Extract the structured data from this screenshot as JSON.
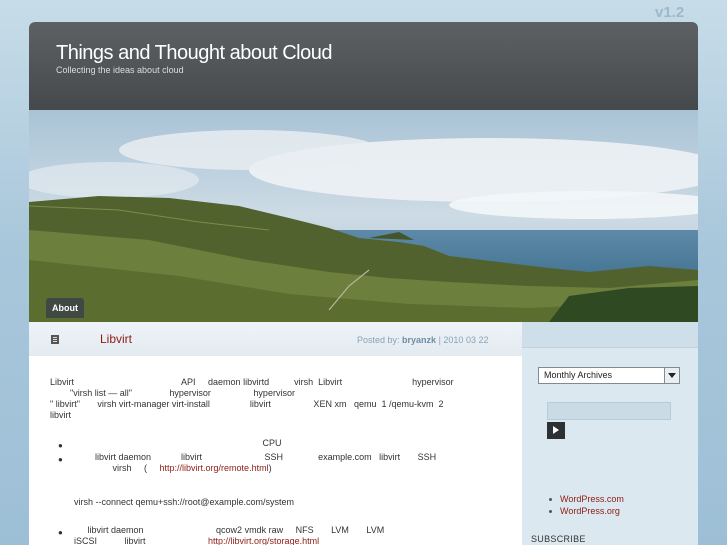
{
  "version": "v1.2",
  "site": {
    "title": "Things and Thought about Cloud",
    "tagline": "Collecting the ideas about cloud"
  },
  "nav": {
    "about": "About"
  },
  "post": {
    "title": "Libvirt",
    "posted_by_label": "Posted by:",
    "author": "bryanzk",
    "date": "| 2010 03 22",
    "lines": [
      "Libvirt                                           API     daemon libvirtd          virsh  Libvirt                            hypervisor",
      "        \"virsh list — all\"               hypervisor                 hypervisor",
      "\" libvirt\"       virsh virt-manager virt-install                libvirt                 XEN xm   qemu  1 /qemu-kvm  2",
      "libvirt"
    ],
    "bullets": [
      {
        "text": "                                                                                     CPU"
      },
      {
        "text": "                  libvirt daemon            libvirt                         SSH              example.com   libvirt       SSH",
        "cont": "                         virsh     (     ",
        "link": "http://libvirt.org/remote.html",
        "after": ")"
      }
    ],
    "command": "virsh --connect qemu+ssh://root@example.com/system",
    "bullet3_text": "               libvirt daemon                             qcow2 vmdk raw     NFS       LVM       LVM",
    "bullet3_cont": "iSCSI           libvirt                         ",
    "bullet3_link": "http://libvirt.org/storage.html"
  },
  "sidebar": {
    "archives": "Monthly Archives",
    "links": [
      "WordPress.com",
      "WordPress.org"
    ],
    "subscribe": "SUBSCRIBE"
  },
  "colors": {
    "link": "#8c1c14",
    "header": "#4a4e51",
    "accent": "#6f8da3"
  }
}
